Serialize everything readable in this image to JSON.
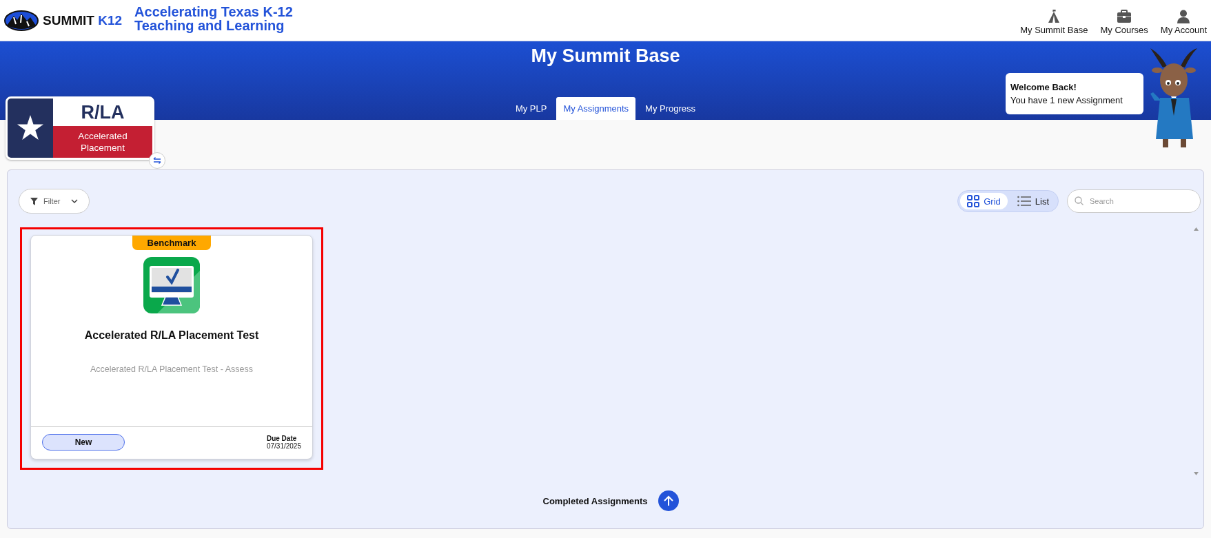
{
  "header": {
    "logo_text": "SUMMIT",
    "logo_accent": "K12",
    "tagline": [
      "Accelerating Texas K-12",
      "Teaching and Learning"
    ],
    "nav": [
      {
        "label": "My Summit Base",
        "kind": "tent"
      },
      {
        "label": "My Courses",
        "kind": "briefcase"
      },
      {
        "label": "My Account",
        "kind": "person"
      }
    ]
  },
  "banner": {
    "title": "My Summit Base",
    "tabs": [
      {
        "label": "My PLP",
        "selected": false
      },
      {
        "label": "My Assignments",
        "selected": true
      },
      {
        "label": "My Progress",
        "selected": false
      }
    ],
    "welcome": {
      "title": "Welcome Back!",
      "message": "You have 1 new Assignment"
    }
  },
  "course_badge": {
    "subject": "R/LA",
    "program": "Accelerated Placement"
  },
  "toolbar": {
    "filter": "Filter",
    "views": [
      {
        "label": "Grid",
        "kind": "grid",
        "selected": true
      },
      {
        "label": "List",
        "kind": "list",
        "selected": false
      }
    ],
    "search": {
      "placeholder": "Search"
    }
  },
  "assignments": [
    {
      "tag": "Benchmark",
      "title": "Accelerated R/LA Placement Test",
      "subtitle": "Accelerated R/LA Placement Test - Assess",
      "status": "New",
      "due_label": "Due Date",
      "due_date": "07/31/2025",
      "highlighted": true
    }
  ],
  "completed": {
    "label": "Completed Assignments"
  }
}
